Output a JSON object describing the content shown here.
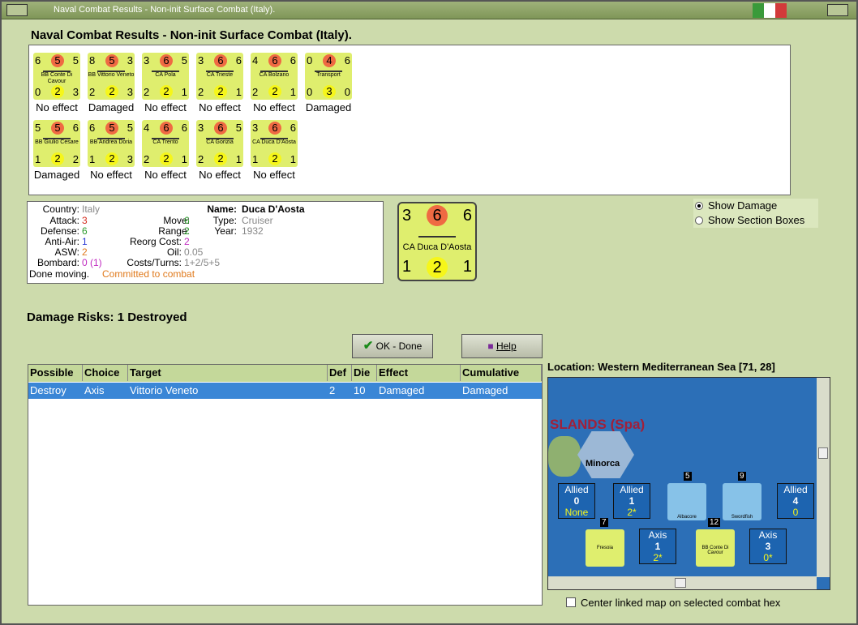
{
  "window": {
    "title": "Naval Combat Results - Non-init Surface Combat (Italy)."
  },
  "heading": "Naval Combat Results - Non-init Surface Combat (Italy).",
  "units": [
    {
      "name": "BB Conte Di Cavour",
      "tl": "6",
      "tm": "5",
      "tr": "5",
      "bl": "0",
      "bm": "2",
      "br": "3",
      "result": "No effect"
    },
    {
      "name": "BB Vittorio Veneto",
      "tl": "8",
      "tm": "5",
      "tr": "3",
      "bl": "2",
      "bm": "2",
      "br": "3",
      "result": "Damaged"
    },
    {
      "name": "CA Pola",
      "tl": "3",
      "tm": "6",
      "tr": "5",
      "bl": "2",
      "bm": "2",
      "br": "1",
      "result": "No effect"
    },
    {
      "name": "CA Trieste",
      "tl": "3",
      "tm": "6",
      "tr": "6",
      "bl": "2",
      "bm": "2",
      "br": "1",
      "result": "No effect"
    },
    {
      "name": "CA Bolzano",
      "tl": "4",
      "tm": "6",
      "tr": "6",
      "bl": "2",
      "bm": "2",
      "br": "1",
      "result": "No effect"
    },
    {
      "name": "Transport",
      "tl": "0",
      "tm": "4",
      "tr": "6",
      "bl": "0",
      "bm": "3",
      "br": "0",
      "result": "Damaged"
    },
    {
      "name": "BB Giulio Cesare",
      "tl": "5",
      "tm": "5",
      "tr": "6",
      "bl": "1",
      "bm": "2",
      "br": "2",
      "result": "Damaged"
    },
    {
      "name": "BB Andrea Doria",
      "tl": "6",
      "tm": "5",
      "tr": "5",
      "bl": "1",
      "bm": "2",
      "br": "3",
      "result": "No effect"
    },
    {
      "name": "CA Trento",
      "tl": "4",
      "tm": "6",
      "tr": "6",
      "bl": "2",
      "bm": "2",
      "br": "1",
      "result": "No effect"
    },
    {
      "name": "CA Gorizia",
      "tl": "3",
      "tm": "6",
      "tr": "5",
      "bl": "2",
      "bm": "2",
      "br": "1",
      "result": "No effect"
    },
    {
      "name": "CA Duca D'Aosta",
      "tl": "3",
      "tm": "6",
      "tr": "6",
      "bl": "1",
      "bm": "2",
      "br": "1",
      "result": "No effect"
    }
  ],
  "info": {
    "country_label": "Country:",
    "country": "Italy",
    "attack_label": "Attack:",
    "attack": "3",
    "defense_label": "Defense:",
    "defense": "6",
    "antiair_label": "Anti-Air:",
    "antiair": "1",
    "asw_label": "ASW:",
    "asw": "2",
    "bombard_label": "Bombard:",
    "bombard": "0 (1)",
    "done": "Done moving.",
    "committed": "Committed to combat",
    "name_label": "Name:",
    "name": "Duca D'Aosta",
    "type_label": "Type:",
    "type": "Cruiser",
    "year_label": "Year:",
    "year": "1932",
    "move_label": "Move:",
    "move": "6",
    "range_label": "Range:",
    "range": "2",
    "reorg_label": "Reorg Cost:",
    "reorg": "2",
    "oil_label": "Oil:",
    "oil": "0.05",
    "costs_label": "Costs/Turns:",
    "costs": "1+2/5+5"
  },
  "big_counter": {
    "tl": "3",
    "tm": "6",
    "tr": "6",
    "name": "CA Duca D'Aosta",
    "bl": "1",
    "bm": "2",
    "br": "1"
  },
  "radio": {
    "show_damage": "Show Damage",
    "show_sections": "Show Section Boxes"
  },
  "damage_risks": "Damage Risks:  1 Destroyed",
  "buttons": {
    "ok": "OK - Done",
    "help": "Help"
  },
  "table": {
    "headers": [
      "Possible",
      "Choice",
      "Target",
      "Def",
      "Die",
      "Effect",
      "Cumulative"
    ],
    "rows": [
      [
        "Destroy",
        "Axis",
        "Vittorio Veneto",
        "2",
        "10",
        "Damaged",
        "Damaged"
      ]
    ]
  },
  "location": "Location:  Western Mediterranean Sea [71, 28]",
  "map": {
    "region": "SLANDS (Spa)",
    "minorca": "Minorca",
    "boxes": [
      {
        "side": "Allied",
        "num": "0",
        "sub": "None"
      },
      {
        "side": "Allied",
        "num": "1",
        "sub": "2*"
      },
      {
        "side": "Allied",
        "num": "4",
        "sub": "0"
      },
      {
        "side": "Axis",
        "num": "1",
        "sub": "2*"
      },
      {
        "side": "Axis",
        "num": "3",
        "sub": "0*"
      }
    ],
    "stack_labels": [
      "5",
      "9",
      "7",
      "12"
    ],
    "unit_names": [
      "Albacore",
      "Swordfish",
      "Fresoia",
      "BB Conte Di Cavour"
    ]
  },
  "center_checkbox": "Center linked map on selected combat hex"
}
